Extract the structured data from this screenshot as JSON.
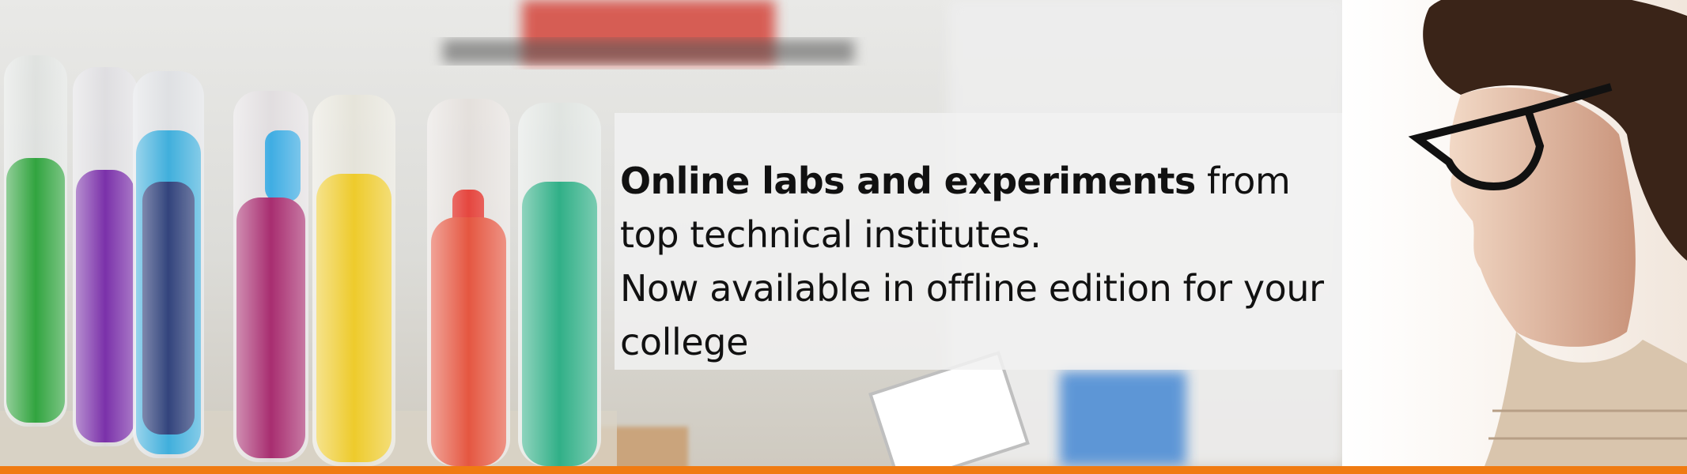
{
  "banner": {
    "headline_bold": "Online labs and experiments",
    "headline_rest": "from top technical institutes.",
    "subline": "Now available in offline edition for your college"
  },
  "colors": {
    "accent": "#f07b12",
    "text": "#111111",
    "text_box_bg": "#f1f1f1"
  }
}
